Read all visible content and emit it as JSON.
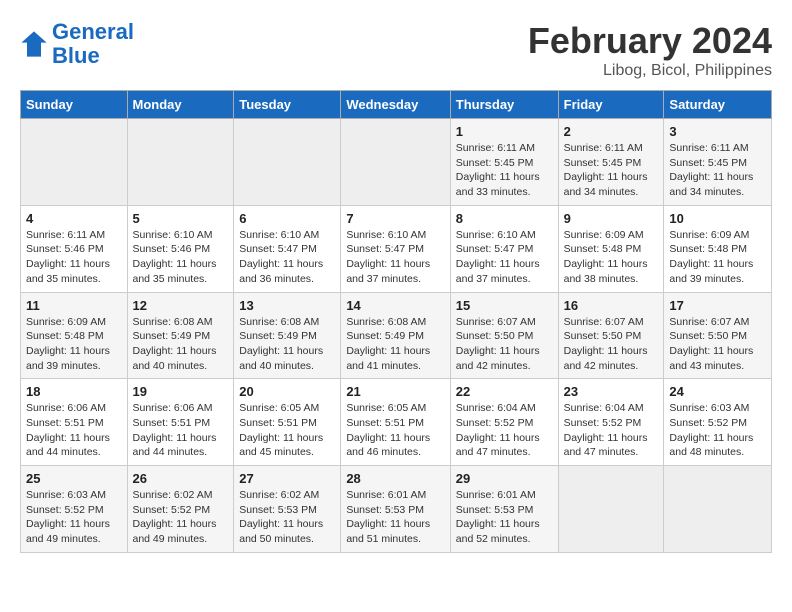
{
  "header": {
    "logo_text_general": "General",
    "logo_text_blue": "Blue",
    "main_title": "February 2024",
    "subtitle": "Libog, Bicol, Philippines"
  },
  "calendar": {
    "days_of_week": [
      "Sunday",
      "Monday",
      "Tuesday",
      "Wednesday",
      "Thursday",
      "Friday",
      "Saturday"
    ],
    "weeks": [
      [
        {
          "day": "",
          "info": ""
        },
        {
          "day": "",
          "info": ""
        },
        {
          "day": "",
          "info": ""
        },
        {
          "day": "",
          "info": ""
        },
        {
          "day": "1",
          "info": "Sunrise: 6:11 AM\nSunset: 5:45 PM\nDaylight: 11 hours\nand 33 minutes."
        },
        {
          "day": "2",
          "info": "Sunrise: 6:11 AM\nSunset: 5:45 PM\nDaylight: 11 hours\nand 34 minutes."
        },
        {
          "day": "3",
          "info": "Sunrise: 6:11 AM\nSunset: 5:45 PM\nDaylight: 11 hours\nand 34 minutes."
        }
      ],
      [
        {
          "day": "4",
          "info": "Sunrise: 6:11 AM\nSunset: 5:46 PM\nDaylight: 11 hours\nand 35 minutes."
        },
        {
          "day": "5",
          "info": "Sunrise: 6:10 AM\nSunset: 5:46 PM\nDaylight: 11 hours\nand 35 minutes."
        },
        {
          "day": "6",
          "info": "Sunrise: 6:10 AM\nSunset: 5:47 PM\nDaylight: 11 hours\nand 36 minutes."
        },
        {
          "day": "7",
          "info": "Sunrise: 6:10 AM\nSunset: 5:47 PM\nDaylight: 11 hours\nand 37 minutes."
        },
        {
          "day": "8",
          "info": "Sunrise: 6:10 AM\nSunset: 5:47 PM\nDaylight: 11 hours\nand 37 minutes."
        },
        {
          "day": "9",
          "info": "Sunrise: 6:09 AM\nSunset: 5:48 PM\nDaylight: 11 hours\nand 38 minutes."
        },
        {
          "day": "10",
          "info": "Sunrise: 6:09 AM\nSunset: 5:48 PM\nDaylight: 11 hours\nand 39 minutes."
        }
      ],
      [
        {
          "day": "11",
          "info": "Sunrise: 6:09 AM\nSunset: 5:48 PM\nDaylight: 11 hours\nand 39 minutes."
        },
        {
          "day": "12",
          "info": "Sunrise: 6:08 AM\nSunset: 5:49 PM\nDaylight: 11 hours\nand 40 minutes."
        },
        {
          "day": "13",
          "info": "Sunrise: 6:08 AM\nSunset: 5:49 PM\nDaylight: 11 hours\nand 40 minutes."
        },
        {
          "day": "14",
          "info": "Sunrise: 6:08 AM\nSunset: 5:49 PM\nDaylight: 11 hours\nand 41 minutes."
        },
        {
          "day": "15",
          "info": "Sunrise: 6:07 AM\nSunset: 5:50 PM\nDaylight: 11 hours\nand 42 minutes."
        },
        {
          "day": "16",
          "info": "Sunrise: 6:07 AM\nSunset: 5:50 PM\nDaylight: 11 hours\nand 42 minutes."
        },
        {
          "day": "17",
          "info": "Sunrise: 6:07 AM\nSunset: 5:50 PM\nDaylight: 11 hours\nand 43 minutes."
        }
      ],
      [
        {
          "day": "18",
          "info": "Sunrise: 6:06 AM\nSunset: 5:51 PM\nDaylight: 11 hours\nand 44 minutes."
        },
        {
          "day": "19",
          "info": "Sunrise: 6:06 AM\nSunset: 5:51 PM\nDaylight: 11 hours\nand 44 minutes."
        },
        {
          "day": "20",
          "info": "Sunrise: 6:05 AM\nSunset: 5:51 PM\nDaylight: 11 hours\nand 45 minutes."
        },
        {
          "day": "21",
          "info": "Sunrise: 6:05 AM\nSunset: 5:51 PM\nDaylight: 11 hours\nand 46 minutes."
        },
        {
          "day": "22",
          "info": "Sunrise: 6:04 AM\nSunset: 5:52 PM\nDaylight: 11 hours\nand 47 minutes."
        },
        {
          "day": "23",
          "info": "Sunrise: 6:04 AM\nSunset: 5:52 PM\nDaylight: 11 hours\nand 47 minutes."
        },
        {
          "day": "24",
          "info": "Sunrise: 6:03 AM\nSunset: 5:52 PM\nDaylight: 11 hours\nand 48 minutes."
        }
      ],
      [
        {
          "day": "25",
          "info": "Sunrise: 6:03 AM\nSunset: 5:52 PM\nDaylight: 11 hours\nand 49 minutes."
        },
        {
          "day": "26",
          "info": "Sunrise: 6:02 AM\nSunset: 5:52 PM\nDaylight: 11 hours\nand 49 minutes."
        },
        {
          "day": "27",
          "info": "Sunrise: 6:02 AM\nSunset: 5:53 PM\nDaylight: 11 hours\nand 50 minutes."
        },
        {
          "day": "28",
          "info": "Sunrise: 6:01 AM\nSunset: 5:53 PM\nDaylight: 11 hours\nand 51 minutes."
        },
        {
          "day": "29",
          "info": "Sunrise: 6:01 AM\nSunset: 5:53 PM\nDaylight: 11 hours\nand 52 minutes."
        },
        {
          "day": "",
          "info": ""
        },
        {
          "day": "",
          "info": ""
        }
      ]
    ]
  }
}
